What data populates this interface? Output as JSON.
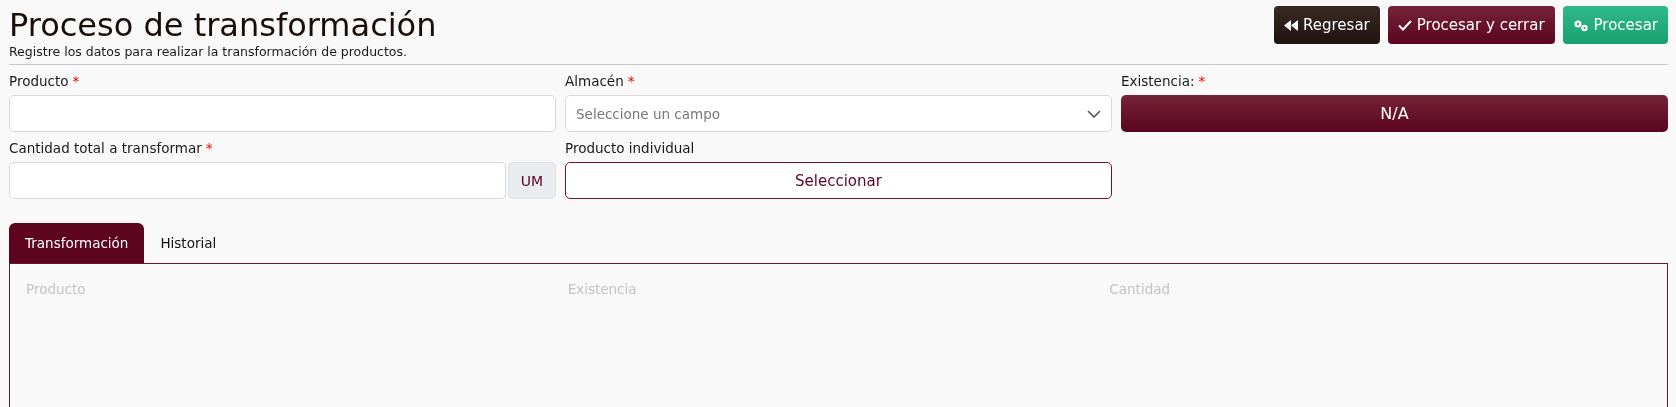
{
  "header": {
    "title": "Proceso de transformación",
    "subtitle": "Registre los datos para realizar la transformación de productos."
  },
  "actions": [
    {
      "kind": "back",
      "label": "Regresar"
    },
    {
      "kind": "process_close",
      "label": "Procesar y cerrar"
    },
    {
      "kind": "process",
      "label": "Procesar"
    }
  ],
  "fields": {
    "producto": {
      "label": "Producto",
      "required_mark": "*"
    },
    "almacen": {
      "label": "Almacén",
      "required_mark": "*",
      "placeholder": "Seleccione un campo"
    },
    "existencia": {
      "label": "Existencia:",
      "required_mark": "*",
      "value": "N/A"
    },
    "cantidad": {
      "label": "Cantidad total a transformar",
      "required_mark": "*",
      "addon": "UM"
    },
    "individual": {
      "label": "Producto individual",
      "button": "Seleccionar"
    }
  },
  "tabs": [
    {
      "label": "Transformación",
      "selected": true
    },
    {
      "label": "Historial",
      "selected": false
    }
  ],
  "table": {
    "columns": [
      "Producto",
      "Existencia",
      "Cantidad"
    ]
  }
}
